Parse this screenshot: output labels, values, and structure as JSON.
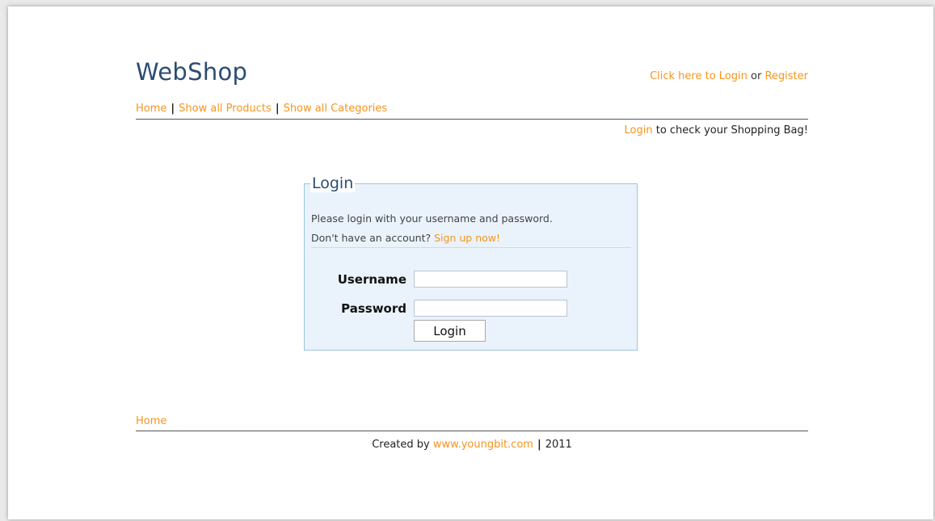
{
  "header": {
    "logo": "WebShop",
    "login_link": "Click here to Login",
    "or_text": "or",
    "register_link": "Register"
  },
  "nav": {
    "items": [
      "Home",
      "Show all Products",
      "Show all Categories"
    ],
    "separator": "|"
  },
  "bag_notice": {
    "login_link": "Login",
    "text": "to check your Shopping Bag!"
  },
  "login_box": {
    "legend": "Login",
    "line1": "Please login with your username and password.",
    "line2_prefix": "Don't have an account?",
    "signup_link": "Sign up now!",
    "username_label": "Username",
    "username_value": "",
    "password_label": "Password",
    "password_value": "",
    "submit_label": "Login"
  },
  "footer": {
    "home_link": "Home",
    "created_by": "Created by",
    "site_link": "www.youngbit.com",
    "separator": "|",
    "year": "2011"
  },
  "colors": {
    "link": "#f7941d",
    "logo": "#2c4c73",
    "login_box_bg": "#eaf3fb",
    "login_box_border": "#9cc4dd"
  }
}
